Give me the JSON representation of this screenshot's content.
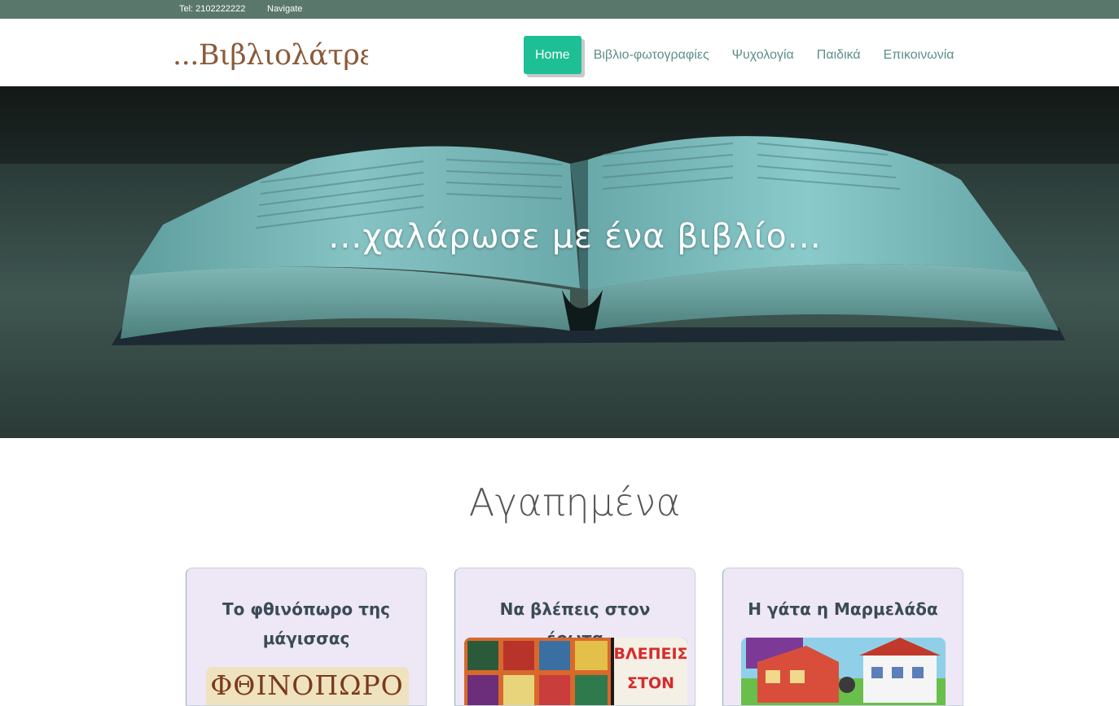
{
  "topbar": {
    "tel": "Tel: 2102222222",
    "navigate": "Navigate"
  },
  "logo": {
    "text": "...Βιβλιολάτρεις..."
  },
  "nav": {
    "items": [
      "Home",
      "Βιβλιο-φωτογραφίες",
      "Ψυχολογία",
      "Παιδικά",
      "Επικοινωνία"
    ],
    "active_color": "#1fbf95"
  },
  "hero": {
    "tagline": "...χαλάρωσε με ένα βιβλίο..."
  },
  "favorites": {
    "title": "Αγαπημένα",
    "cards": [
      {
        "title": "Το φθινόπωρο της μάγισσας",
        "cover_text": "ΦΘΙΝΟΠΩΡΟ"
      },
      {
        "title": "Να βλέπεις στον έρωτα",
        "cover_text_line1": "ΒΛΕΠΕΙΣ",
        "cover_text_line2": "ΣΤΟΝ"
      },
      {
        "title": "Η γάτα η Μαρμελάδα"
      }
    ]
  },
  "colors": {
    "topbar": "#5a776c",
    "nav_text": "#5e8e88",
    "card_bg": "#ede7f6"
  }
}
